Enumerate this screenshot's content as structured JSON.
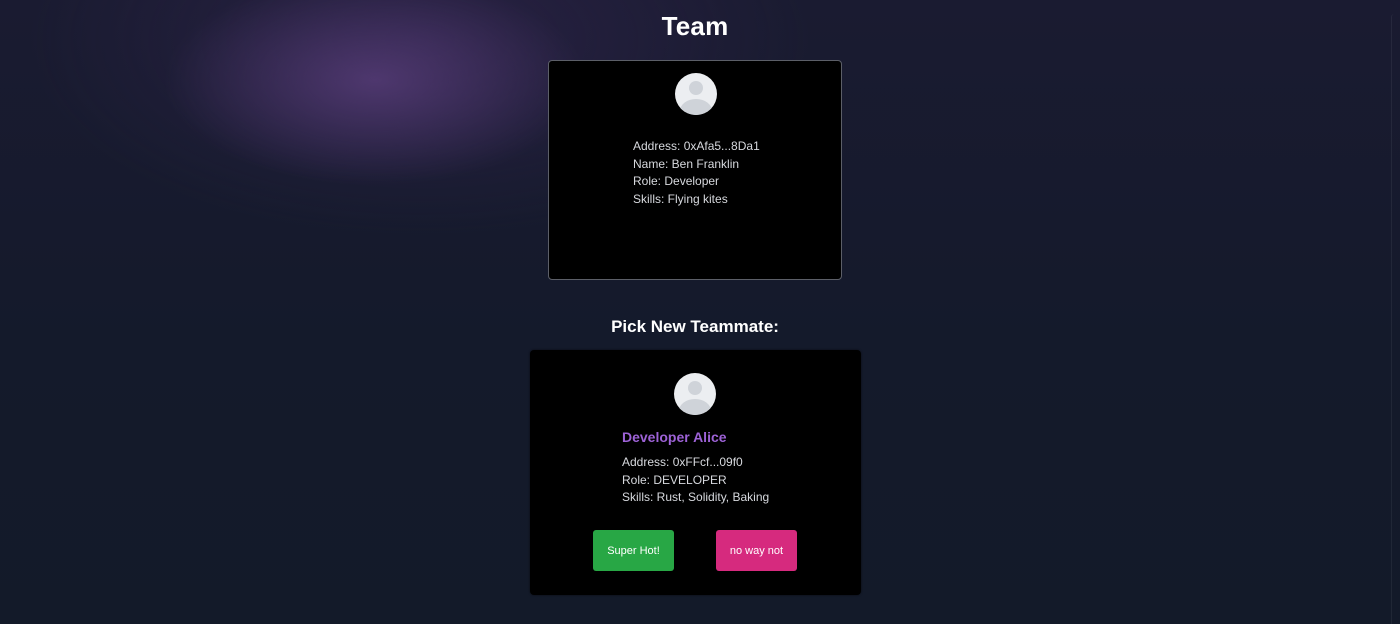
{
  "page": {
    "title": "Team"
  },
  "team": {
    "members": [
      {
        "address_label": "Address: 0xAfa5...8Da1",
        "name_label": "Name: Ben Franklin",
        "role_label": "Role: Developer",
        "skills_label": "Skills: Flying kites"
      }
    ]
  },
  "picker": {
    "title": "Pick New Teammate:",
    "candidate": {
      "name": "Developer Alice",
      "address_label": "Address: 0xFFcf...09f0",
      "role_label": "Role: DEVELOPER",
      "skills_label": "Skills: Rust, Solidity, Baking"
    },
    "accept_label": "Super Hot!",
    "reject_label": "no way not"
  },
  "icons": {
    "avatar": "user-avatar-icon"
  },
  "colors": {
    "background": "#151a2c",
    "card": "#000000",
    "candidate_name": "#9d62d6",
    "accept": "#28a745",
    "reject": "#d62a7e"
  }
}
